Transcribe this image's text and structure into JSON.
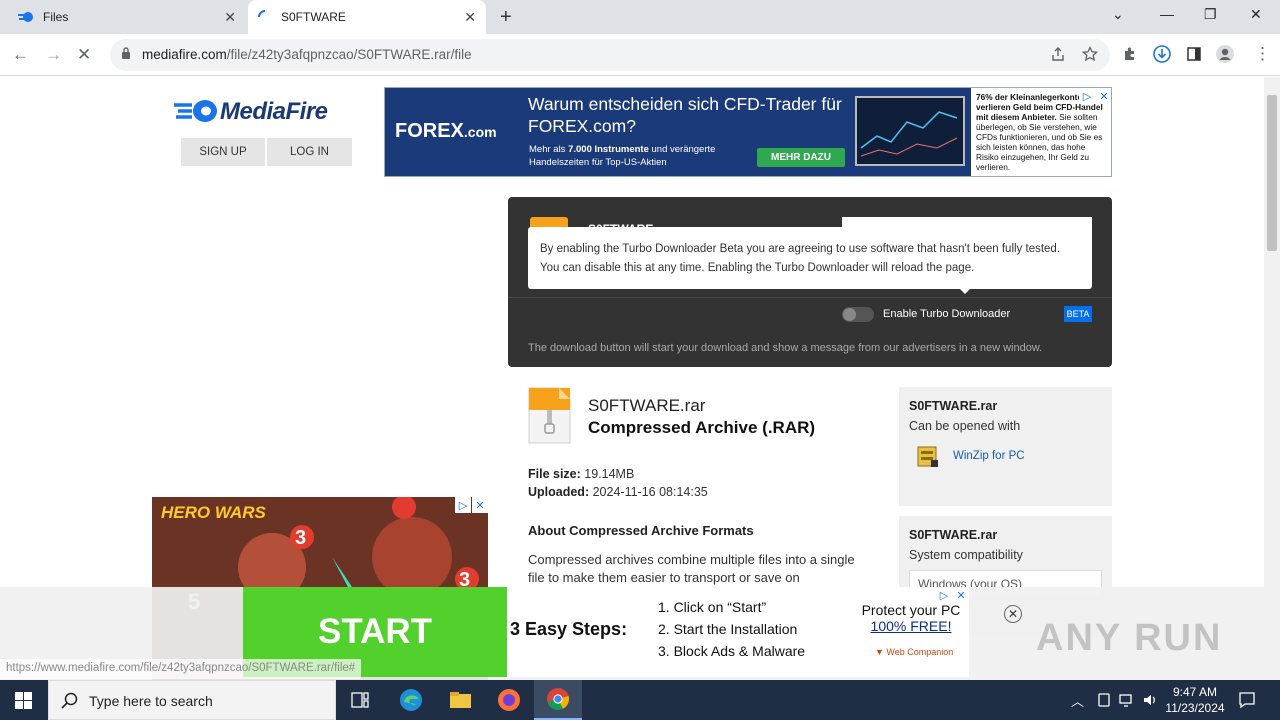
{
  "browser": {
    "tabs": [
      {
        "title": "Files",
        "icon": "mediafire-icon"
      },
      {
        "title": "S0FTWARE",
        "icon": "loading-spinner-icon"
      }
    ],
    "url_host": "mediafire.com",
    "url_path": "/file/z42ty3afqpnzcao/S0FTWARE.rar/file",
    "status_url": "https://www.mediafire.com/file/z42ty3afqpnzcao/S0FTWARE.rar/file#"
  },
  "header": {
    "logo_text": "MediaFire",
    "signup_label": "SIGN UP",
    "login_label": "LOG IN"
  },
  "top_ad": {
    "brand": "FOREX",
    "brand_suffix": ".com",
    "headline": "Warum entscheiden sich CFD-Trader für FOREX.com?",
    "sub_prefix": "Mehr als ",
    "sub_bold": "7.000 Instrumente",
    "sub_suffix": " und verängerte Handelszeiten für Top-US-Aktien",
    "cta": "MEHR DAZU",
    "disclaimer_bold": "76% der Kleinanlegerkonten verlieren Geld beim CFD-Handel mit diesem Anbieter.",
    "disclaimer_rest": " Sie sollten überlegen, ob Sie verstehen, wie CFDs funktionieren, und ob Sie es sich leisten können, das hohe Risiko einzugehen, Ihr Geld zu verlieren."
  },
  "download": {
    "file_label": "S0FTWARE",
    "tooltip": "By enabling the Turbo Downloader Beta you are agreeing to use software that hasn't been fully tested. You can disable this at any time. Enabling the Turbo Downloader will reload the page.",
    "toggle_label": "Enable Turbo Downloader",
    "toggle_on": false,
    "beta_badge": "BETA",
    "note": "The download button will start your download and show a message from our advertisers in a new window."
  },
  "file": {
    "name": "S0FTWARE.rar",
    "type": "Compressed Archive (.RAR)",
    "size_label": "File size:",
    "size_value": "19.14MB",
    "uploaded_label": "Uploaded:",
    "uploaded_value": "2024-11-16 08:14:35",
    "about_heading": "About Compressed Archive Formats",
    "description": "Compressed archives combine multiple files into a single file to make them easier to transport or save on"
  },
  "sidebar": {
    "card1_name": "S0FTWARE.rar",
    "card1_label": "Can be opened with",
    "app_name": "WinZip for PC",
    "card2_name": "S0FTWARE.rar",
    "card2_label": "System compatibility",
    "select_value": "Windows (your OS)"
  },
  "side_ad": {
    "brand": "HERO WARS"
  },
  "bottom_ad": {
    "start": "START",
    "steps_heading": "3 Easy Steps:",
    "steps": [
      "1. Click on “Start”",
      "2. Start the Installation",
      "3. Block Ads & Malware"
    ],
    "protect_line1": "Protect your PC",
    "protect_line2": "100% FREE!",
    "vendor": "Web Companion"
  },
  "watermark": "ANY RUN",
  "taskbar": {
    "search_placeholder": "Type here to search",
    "time": "9:47 AM",
    "date": "11/23/2024"
  },
  "colors": {
    "accent": "#1a73e8",
    "mediafire_blue": "#1a3a73",
    "start_green": "#52d12c"
  }
}
